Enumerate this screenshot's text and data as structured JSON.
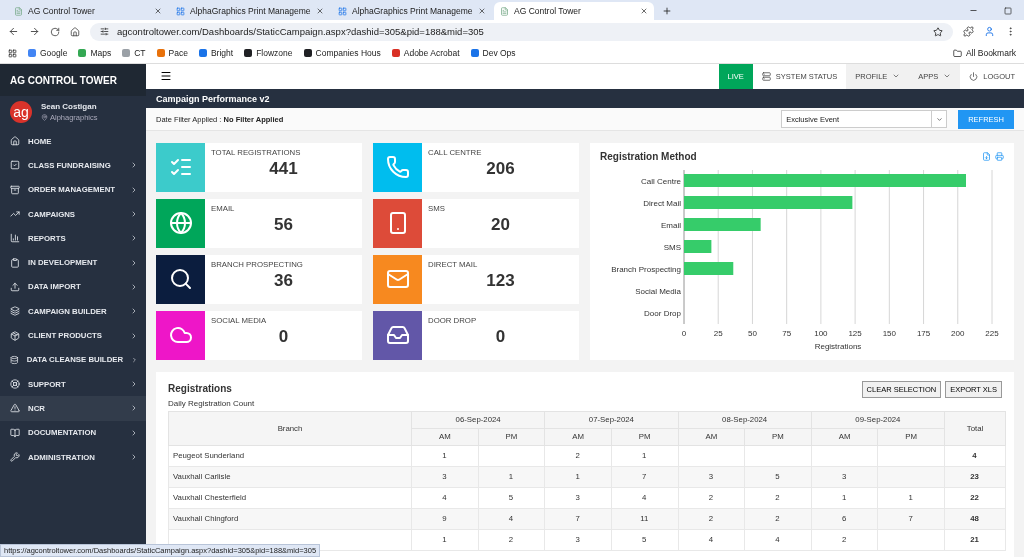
{
  "browser": {
    "tabs": [
      {
        "title": "AG Control Tower",
        "selected": false
      },
      {
        "title": "AlphaGraphics Print Manageme",
        "selected": false
      },
      {
        "title": "AlphaGraphics Print Manageme",
        "selected": false
      },
      {
        "title": "AG Control Tower",
        "selected": true
      }
    ],
    "address": "agcontroltower.com/Dashboards/StaticCampaign.aspx?dashid=305&pid=188&mid=305",
    "bookmarks": [
      {
        "label": "Google",
        "color": "#4285f4"
      },
      {
        "label": "Maps",
        "color": "#34a853"
      },
      {
        "label": "CT",
        "color": "#9aa0a6"
      },
      {
        "label": "Pace",
        "color": "#e8710a"
      },
      {
        "label": "Bright",
        "color": "#1a73e8"
      },
      {
        "label": "Flowzone",
        "color": "#202124"
      },
      {
        "label": "Companies Hous",
        "color": "#202124"
      },
      {
        "label": "Adobe Acrobat",
        "color": "#d93025"
      },
      {
        "label": "Dev Ops",
        "color": "#1a73e8"
      }
    ],
    "all_bookmarks": "All Bookmark",
    "status_url": "https://agcontroltower.com/Dashboards/StaticCampaign.aspx?dashid=305&pid=188&mid=305"
  },
  "app": {
    "brand": "AG CONTROL TOWER",
    "user": {
      "avatar": "ag",
      "name": "Sean Costigan",
      "org": "Alphagraphics"
    },
    "nav": [
      {
        "label": "HOME",
        "submenu": false,
        "selected": false
      },
      {
        "label": "CLASS FUNDRAISING",
        "submenu": true,
        "selected": false
      },
      {
        "label": "ORDER MANAGEMENT",
        "submenu": true,
        "selected": false
      },
      {
        "label": "CAMPAIGNS",
        "submenu": true,
        "selected": false
      },
      {
        "label": "REPORTS",
        "submenu": true,
        "selected": false
      },
      {
        "label": "IN DEVELOPMENT",
        "submenu": true,
        "selected": false
      },
      {
        "label": "DATA IMPORT",
        "submenu": true,
        "selected": false
      },
      {
        "label": "CAMPAIGN BUILDER",
        "submenu": true,
        "selected": false
      },
      {
        "label": "CLIENT PRODUCTS",
        "submenu": true,
        "selected": false
      },
      {
        "label": "DATA CLEANSE BUILDER",
        "submenu": true,
        "selected": false
      },
      {
        "label": "SUPPORT",
        "submenu": true,
        "selected": false
      },
      {
        "label": "NCR",
        "submenu": true,
        "selected": true
      },
      {
        "label": "DOCUMENTATION",
        "submenu": true,
        "selected": false
      },
      {
        "label": "ADMINISTRATION",
        "submenu": true,
        "selected": false
      }
    ],
    "topnav": [
      {
        "label": "LIVE",
        "kind": "live"
      },
      {
        "label": "SYSTEM STATUS",
        "kind": "status"
      },
      {
        "label": "PROFILE",
        "kind": "menu"
      },
      {
        "label": "APPS",
        "kind": "menu"
      },
      {
        "label": "LOGOUT",
        "kind": "logout"
      }
    ],
    "page_title": "Campaign Performance v2",
    "filter": {
      "label": "Date Filter Applied :",
      "value": "No Filter Applied",
      "select": "Exclusive Event",
      "refresh": "REFRESH"
    },
    "stats": [
      {
        "label": "TOTAL REGISTRATIONS",
        "value": "441",
        "color": "#3ccbcb"
      },
      {
        "label": "CALL CENTRE",
        "value": "206",
        "color": "#00bdee"
      },
      {
        "label": "EMAIL",
        "value": "56",
        "color": "#00a65a"
      },
      {
        "label": "SMS",
        "value": "20",
        "color": "#dd4b39"
      },
      {
        "label": "BRANCH PROSPECTING",
        "value": "36",
        "color": "#0b1d3e"
      },
      {
        "label": "DIRECT MAIL",
        "value": "123",
        "color": "#f7891f"
      },
      {
        "label": "SOCIAL MEDIA",
        "value": "0",
        "color": "#ee16c8"
      },
      {
        "label": "DOOR DROP",
        "value": "0",
        "color": "#6257a8"
      }
    ],
    "method": {
      "title": "Registration Method",
      "chart_data": {
        "type": "bar",
        "orientation": "horizontal",
        "grid": true,
        "xlabel": "Registrations",
        "categories": [
          "Call Centre",
          "Direct Mail",
          "Email",
          "SMS",
          "Branch Prospecting",
          "Social Media",
          "Door Drop"
        ],
        "series": [
          {
            "color": "#36cc6a",
            "values": [
              206,
              123,
              56,
              20,
              36,
              0,
              0
            ]
          }
        ],
        "xlim": [
          0,
          225
        ],
        "xticks": [
          0,
          25,
          50,
          75,
          100,
          125,
          150,
          175,
          200,
          225
        ]
      }
    },
    "registrations": {
      "title": "Registrations",
      "subtitle": "Daily Registration Count",
      "buttons": [
        "CLEAR SELECTION",
        "EXPORT XLS"
      ],
      "branch_header": "Branch",
      "dates": [
        {
          "date": "06-Sep-2024",
          "am": "AM",
          "pm": "PM"
        },
        {
          "date": "07-Sep-2024",
          "am": "AM",
          "pm": "PM"
        },
        {
          "date": "08-Sep-2024",
          "am": "AM",
          "pm": "PM"
        },
        {
          "date": "09-Sep-2024",
          "am": "AM",
          "pm": "PM"
        }
      ],
      "total_header": "Total",
      "rows": [
        {
          "branch": "Peugeot Sunderland",
          "cells": [
            "1",
            null,
            "2",
            "1",
            null,
            null,
            null,
            null
          ],
          "total": "4"
        },
        {
          "branch": "Vauxhall Carlisle",
          "cells": [
            "3",
            "1",
            "1",
            "7",
            "3",
            "5",
            "3",
            null
          ],
          "total": "23"
        },
        {
          "branch": "Vauxhall Chesterfield",
          "cells": [
            "4",
            "5",
            "3",
            "4",
            "2",
            "2",
            "1",
            "1"
          ],
          "total": "22"
        },
        {
          "branch": "Vauxhall Chingford",
          "cells": [
            "9",
            "4",
            "7",
            "11",
            "2",
            "2",
            "6",
            "7"
          ],
          "total": "48"
        },
        {
          "branch": null,
          "cells": [
            "1",
            "2",
            "3",
            "5",
            "4",
            "4",
            "2",
            null
          ],
          "total": "21"
        }
      ]
    }
  }
}
